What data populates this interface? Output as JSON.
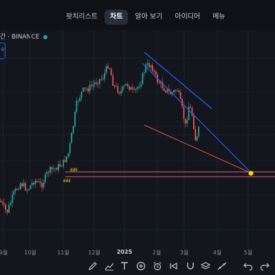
{
  "topbar": {
    "tabs": [
      {
        "label": "왓치리스트",
        "active": false
      },
      {
        "label": "차트",
        "active": true
      },
      {
        "label": "알아 보기",
        "active": false
      },
      {
        "label": "아이디어",
        "active": false
      },
      {
        "label": "메뉴",
        "active": false
      }
    ]
  },
  "symbol": {
    "text": "간 · BINANCE",
    "status_color": "#26a69a"
  },
  "left_box_label": "0",
  "x_axis": {
    "labels": [
      {
        "text": "9월",
        "bold": false
      },
      {
        "text": "10월",
        "bold": false
      },
      {
        "text": "11월",
        "bold": false
      },
      {
        "text": "12월",
        "bold": false
      },
      {
        "text": "2025",
        "bold": true
      },
      {
        "text": "2월",
        "bold": false
      },
      {
        "text": "3월",
        "bold": false
      },
      {
        "text": "4월",
        "bold": false
      },
      {
        "text": "5월",
        "bold": false
      }
    ]
  },
  "annotations": {
    "upper": "68k",
    "lower": "66k"
  },
  "colors": {
    "up": "#26a69a",
    "down": "#ef5350",
    "channel": "#2962ff",
    "support": "#ef5350",
    "horizontal": "#f05a78",
    "marker": "#ffd600",
    "annotation": "#ffd600"
  },
  "toolbar": {
    "icons": [
      "pencil-icon",
      "trend-icon",
      "text-icon",
      "plus-icon",
      "alarm-icon",
      "replay-icon",
      "magnet-icon",
      "layers-icon",
      "lines-icon",
      "undo-icon",
      "redo-icon"
    ]
  }
}
